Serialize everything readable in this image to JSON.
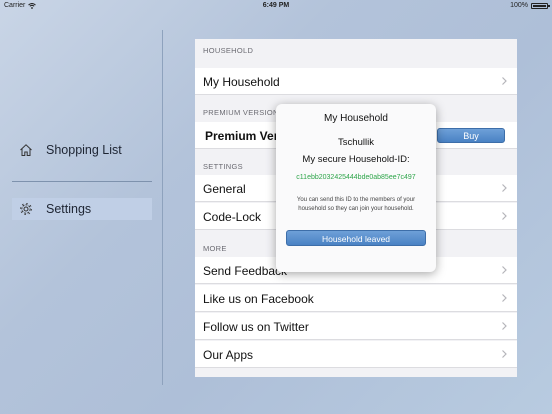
{
  "status_bar": {
    "carrier": "Carrier",
    "time": "6:49 PM",
    "battery": "100%"
  },
  "sidebar": {
    "items": [
      {
        "label": "Shopping List",
        "icon": "home-icon"
      },
      {
        "label": "Settings",
        "icon": "gear-icon",
        "active": true
      }
    ]
  },
  "settings": {
    "sections": {
      "household": "HOUSEHOLD",
      "premium": "PREMIUM VERSION",
      "settings": "SETTINGS",
      "more": "MORE"
    },
    "rows": {
      "my_household": "My Household",
      "premium_version": "Premium Version",
      "buy": "Buy",
      "general": "General",
      "code_lock": "Code-Lock",
      "send_feedback": "Send Feedback",
      "facebook": "Like us on Facebook",
      "twitter": "Follow us on Twitter",
      "our_apps": "Our Apps"
    }
  },
  "popover": {
    "title": "My Household",
    "name": "Tschullik",
    "id_label": "My secure Household-ID:",
    "id_value": "c11ebb2032425444bde0ab85ee7c497",
    "hint": "You can send this ID to the members of your household so they can join your household.",
    "button": "Household leaved"
  },
  "colors": {
    "accent_blue": "#4a82c4",
    "id_green": "#2ea54a",
    "sidebar_active": "#c0cfe6"
  }
}
